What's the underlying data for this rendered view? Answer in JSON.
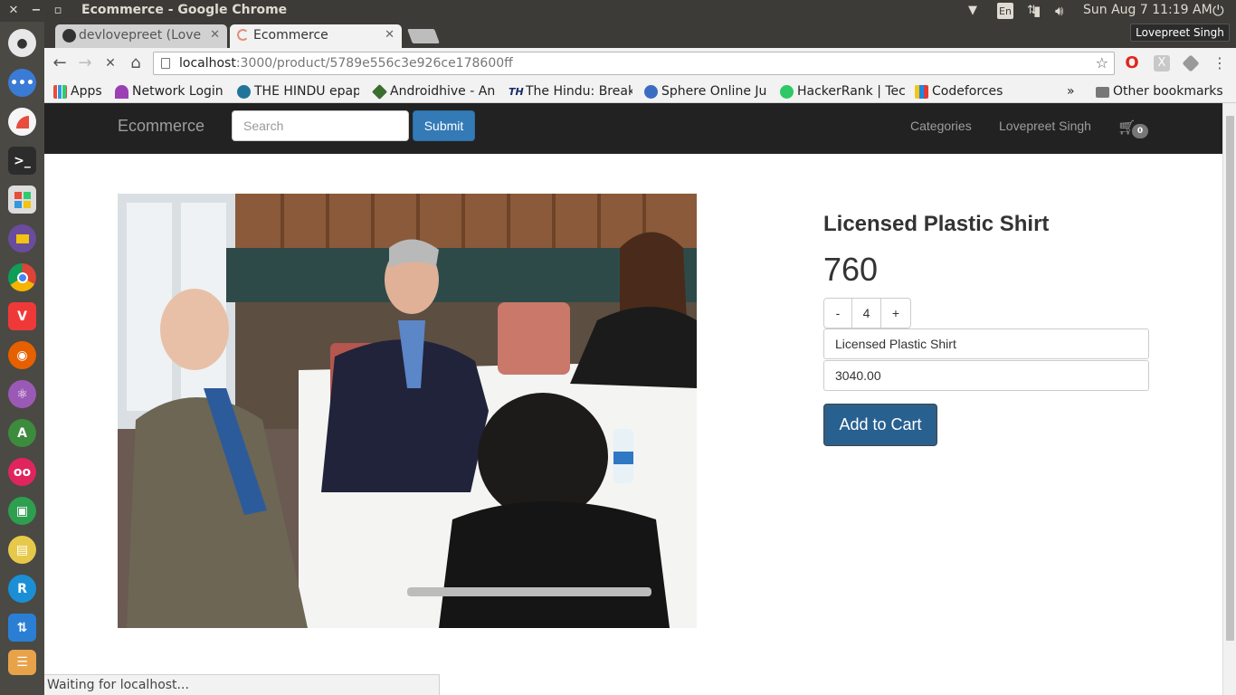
{
  "desktop": {
    "window_title": "Ecommerce - Google Chrome",
    "clock": "Sun Aug  7 11:19 AM",
    "keyboard_layout": "En",
    "user_tooltip": "Lovepreet Singh"
  },
  "browser": {
    "tabs": [
      {
        "title": "devlovepreet (Love",
        "active": false
      },
      {
        "title": "Ecommerce",
        "active": true
      }
    ],
    "url": {
      "host": "localhost",
      "path": ":3000/product/5789e556c3e926ce178600ff"
    },
    "bookmarks": [
      {
        "label": "Apps",
        "icon": "apps-grid-icon"
      },
      {
        "label": "Network Login",
        "icon": "umbrella-icon"
      },
      {
        "label": "THE HINDU epap",
        "icon": "wordpress-icon"
      },
      {
        "label": "Androidhive - An",
        "icon": "androidhive-icon"
      },
      {
        "label": "The Hindu: Break",
        "icon": "the-hindu-icon"
      },
      {
        "label": "Sphere Online Ju",
        "icon": "sphere-icon"
      },
      {
        "label": "HackerRank | Tec",
        "icon": "hackerrank-icon"
      },
      {
        "label": "Codeforces",
        "icon": "codeforces-icon"
      }
    ],
    "overflow_label": "»",
    "other_bookmarks": "Other bookmarks",
    "status_text": "Waiting for localhost..."
  },
  "site": {
    "brand": "Ecommerce",
    "search_placeholder": "Search",
    "submit_label": "Submit",
    "nav_categories": "Categories",
    "nav_user": "Lovepreet Singh",
    "cart_count": "0"
  },
  "product": {
    "name": "Licensed Plastic Shirt",
    "price": "760",
    "qty_minus": "-",
    "quantity": "4",
    "qty_plus": "+",
    "name_field": "Licensed Plastic Shirt",
    "total_field": "3040.00",
    "add_to_cart": "Add to Cart"
  }
}
